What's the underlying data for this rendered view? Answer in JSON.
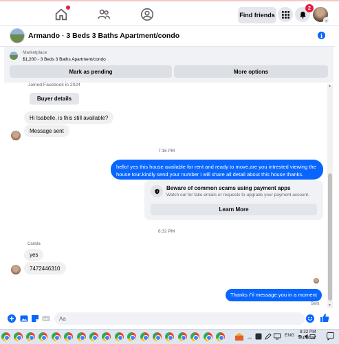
{
  "topnav": {
    "find_friends": "Find friends",
    "notifications_count": "2",
    "profile_chevron": "⌄"
  },
  "chat": {
    "title": "Armando · 3 Beds 3 Baths Apartment/condo"
  },
  "marketplace": {
    "label": "Marketplace",
    "item": "$1,200 - 3 Beds 3 Baths Apartment/condo",
    "mark_pending": "Mark as pending",
    "more_options": "More options"
  },
  "messages": {
    "joined": "Joined Facebook in 2024",
    "buyer_details": "Buyer details",
    "msg1": "Hi Isabelle, is this still available?",
    "msg2": "Message sent",
    "time1": "7:16 PM",
    "outgoing1": "hello! yes this house available for rent and ready to move.are you intrested viewing the house tour.kindly send your number i will share all detail about this house thanks.",
    "scam_title": "Beware of common scams using payment apps",
    "scam_sub": "Watch out for fake emails or requests to upgrade your payment account.",
    "learn_more": "Learn More",
    "time2": "8:32 PM",
    "sender_name": "Camila",
    "msg3": "yes",
    "msg4": "7472446310",
    "outgoing2": "Thanks i\"il message you in a moment",
    "status": "Sent"
  },
  "composer": {
    "placeholder": "Aa"
  },
  "taskbar": {
    "lang": "ENG",
    "time": "8:32 PM",
    "date": "2/4/2025"
  },
  "colors": {
    "accent": "#0866ff",
    "badge": "#e41e3f"
  }
}
